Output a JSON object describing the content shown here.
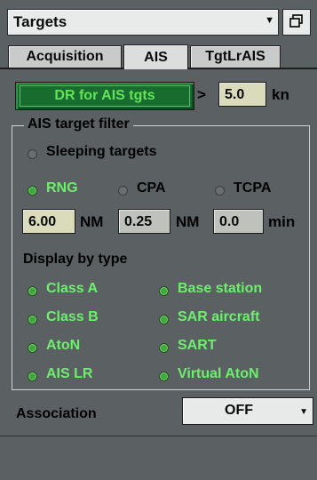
{
  "window": {
    "title": "Targets"
  },
  "tabs": [
    {
      "label": "Acquisition",
      "active": false
    },
    {
      "label": "AIS",
      "active": true
    },
    {
      "label": "TgtLrAIS",
      "active": false
    }
  ],
  "dr_button": {
    "label": "DR for AIS tgts"
  },
  "speed_filter": {
    "operator": ">",
    "value": "5.0",
    "unit": "kn"
  },
  "filter_group": {
    "legend": "AIS target filter",
    "sleeping": {
      "label": "Sleeping targets",
      "selected": false
    },
    "criteria": [
      {
        "label": "RNG",
        "selected": true,
        "value": "6.00",
        "unit": "NM"
      },
      {
        "label": "CPA",
        "selected": false,
        "value": "0.25",
        "unit": "NM"
      },
      {
        "label": "TCPA",
        "selected": false,
        "value": "0.0",
        "unit": "min"
      }
    ],
    "display_by_type": {
      "label": "Display by type",
      "types": [
        "Class A",
        "Base station",
        "Class B",
        "SAR aircraft",
        "AtoN",
        "SART",
        "AIS LR",
        "Virtual AtoN"
      ]
    }
  },
  "association": {
    "label": "Association",
    "value": "OFF"
  },
  "colors": {
    "active_green": "#6cf06c",
    "panel_bg": "#5b6063",
    "button_green": "#176c2e"
  }
}
